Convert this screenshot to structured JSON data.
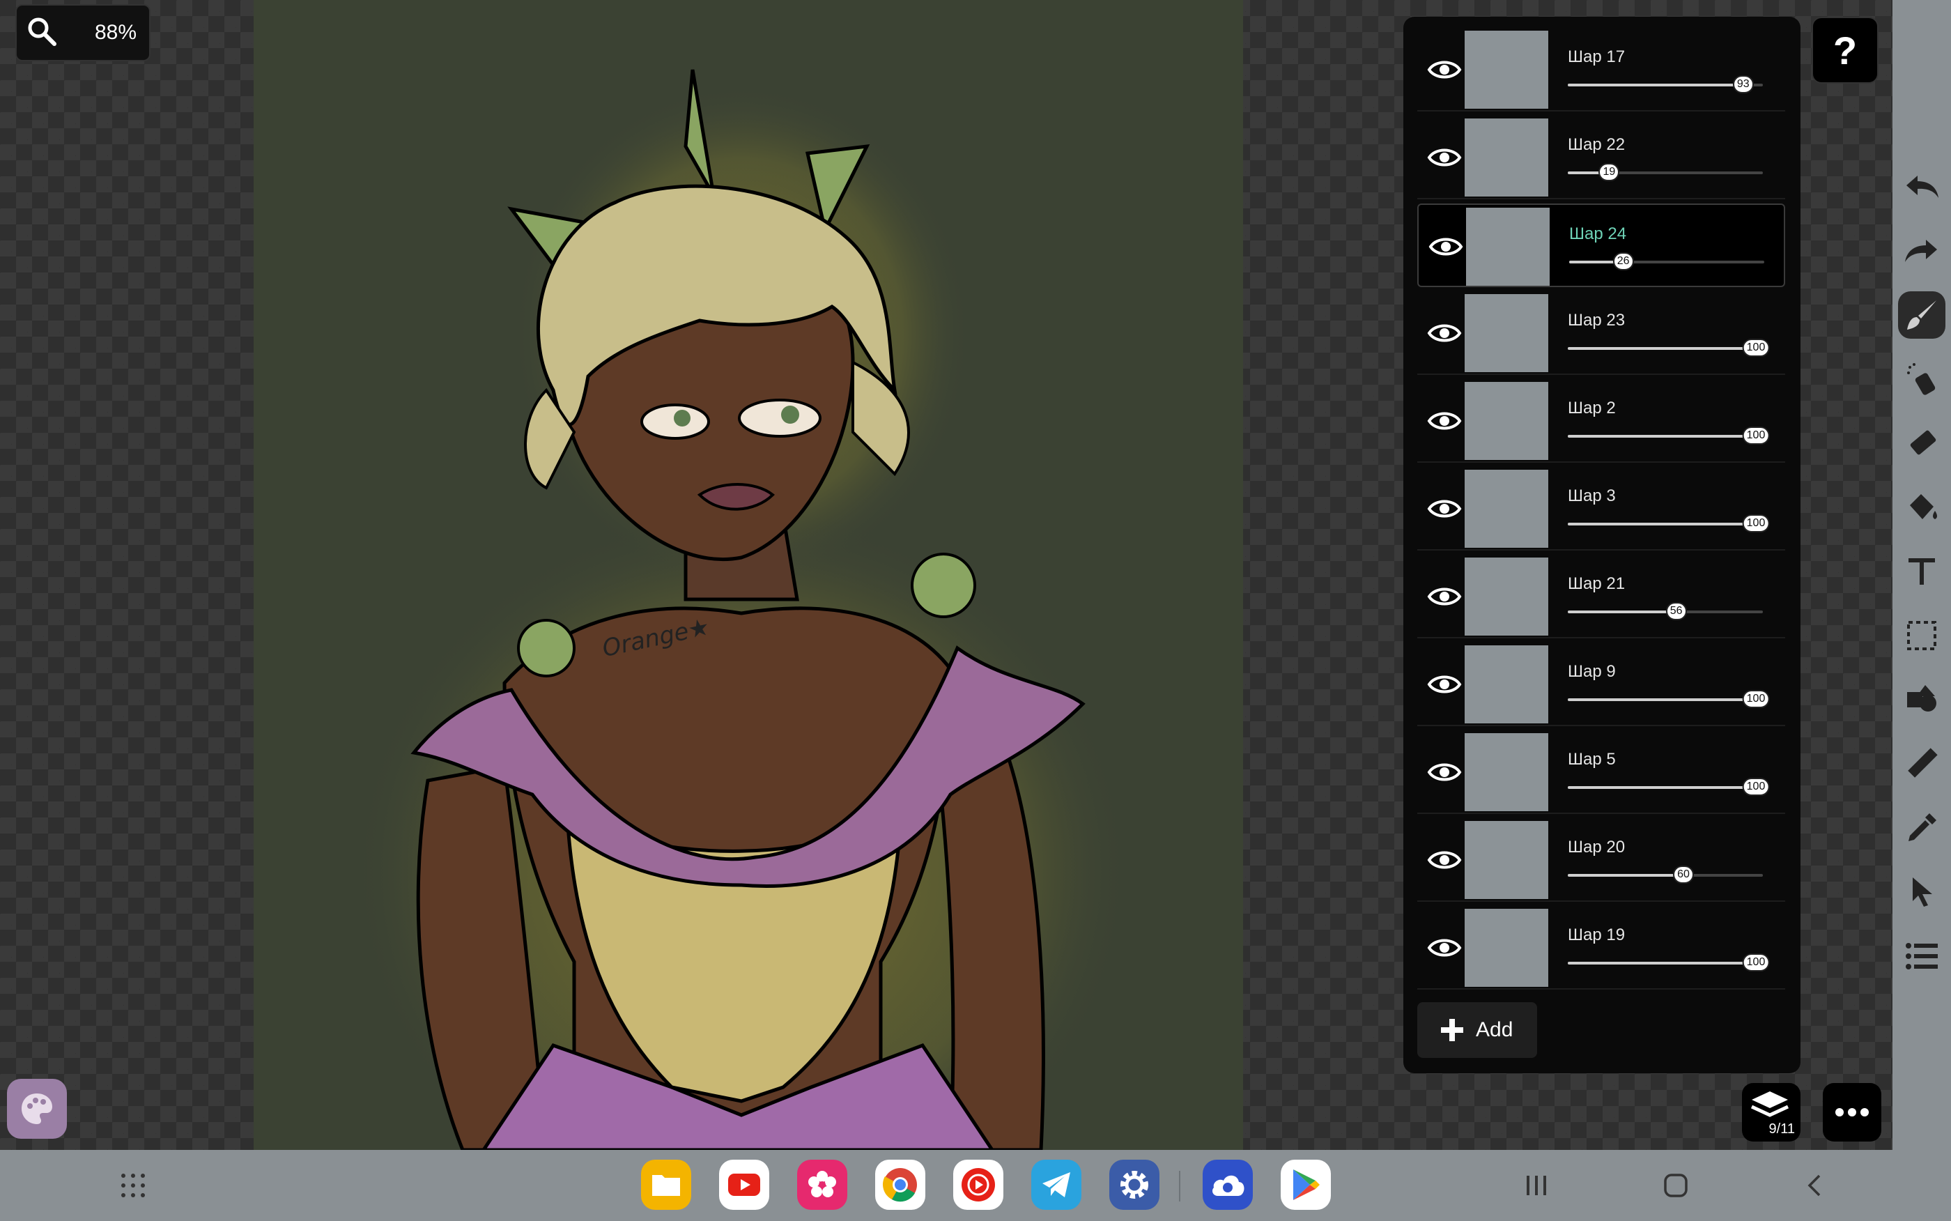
{
  "zoom": {
    "value": "88%"
  },
  "layers": {
    "items": [
      {
        "name": "Шар 17",
        "opacity": 93
      },
      {
        "name": "Шар 22",
        "opacity": 19
      },
      {
        "name": "Шар 24",
        "opacity": 26,
        "selected": true
      },
      {
        "name": "Шар 23",
        "opacity": 100
      },
      {
        "name": "Шар 2",
        "opacity": 100
      },
      {
        "name": "Шар 3",
        "opacity": 100
      },
      {
        "name": "Шар 21",
        "opacity": 56
      },
      {
        "name": "Шар 9",
        "opacity": 100
      },
      {
        "name": "Шар 5",
        "opacity": 100
      },
      {
        "name": "Шар 20",
        "opacity": 60
      },
      {
        "name": "Шар 19",
        "opacity": 100
      }
    ],
    "add_label": "Add",
    "count": "9/11"
  },
  "help": {
    "label": "?"
  },
  "colors": {
    "accent_selected_text": "#6fd3b7",
    "panel_bg": "#0a0a0a",
    "canvas_bg": "#3b4233"
  },
  "tools": [
    "undo-icon",
    "redo-icon",
    "brush-icon",
    "spray-icon",
    "eraser-icon",
    "fill-icon",
    "text-icon",
    "selection-icon",
    "shapes-icon",
    "ruler-icon",
    "eyedropper-icon",
    "pointer-icon",
    "menu-list-icon"
  ],
  "taskbar": {
    "apps": [
      "files",
      "youtube",
      "gallery",
      "chrome",
      "youtube-music",
      "telegram",
      "settings",
      "cloud",
      "play-store"
    ]
  }
}
